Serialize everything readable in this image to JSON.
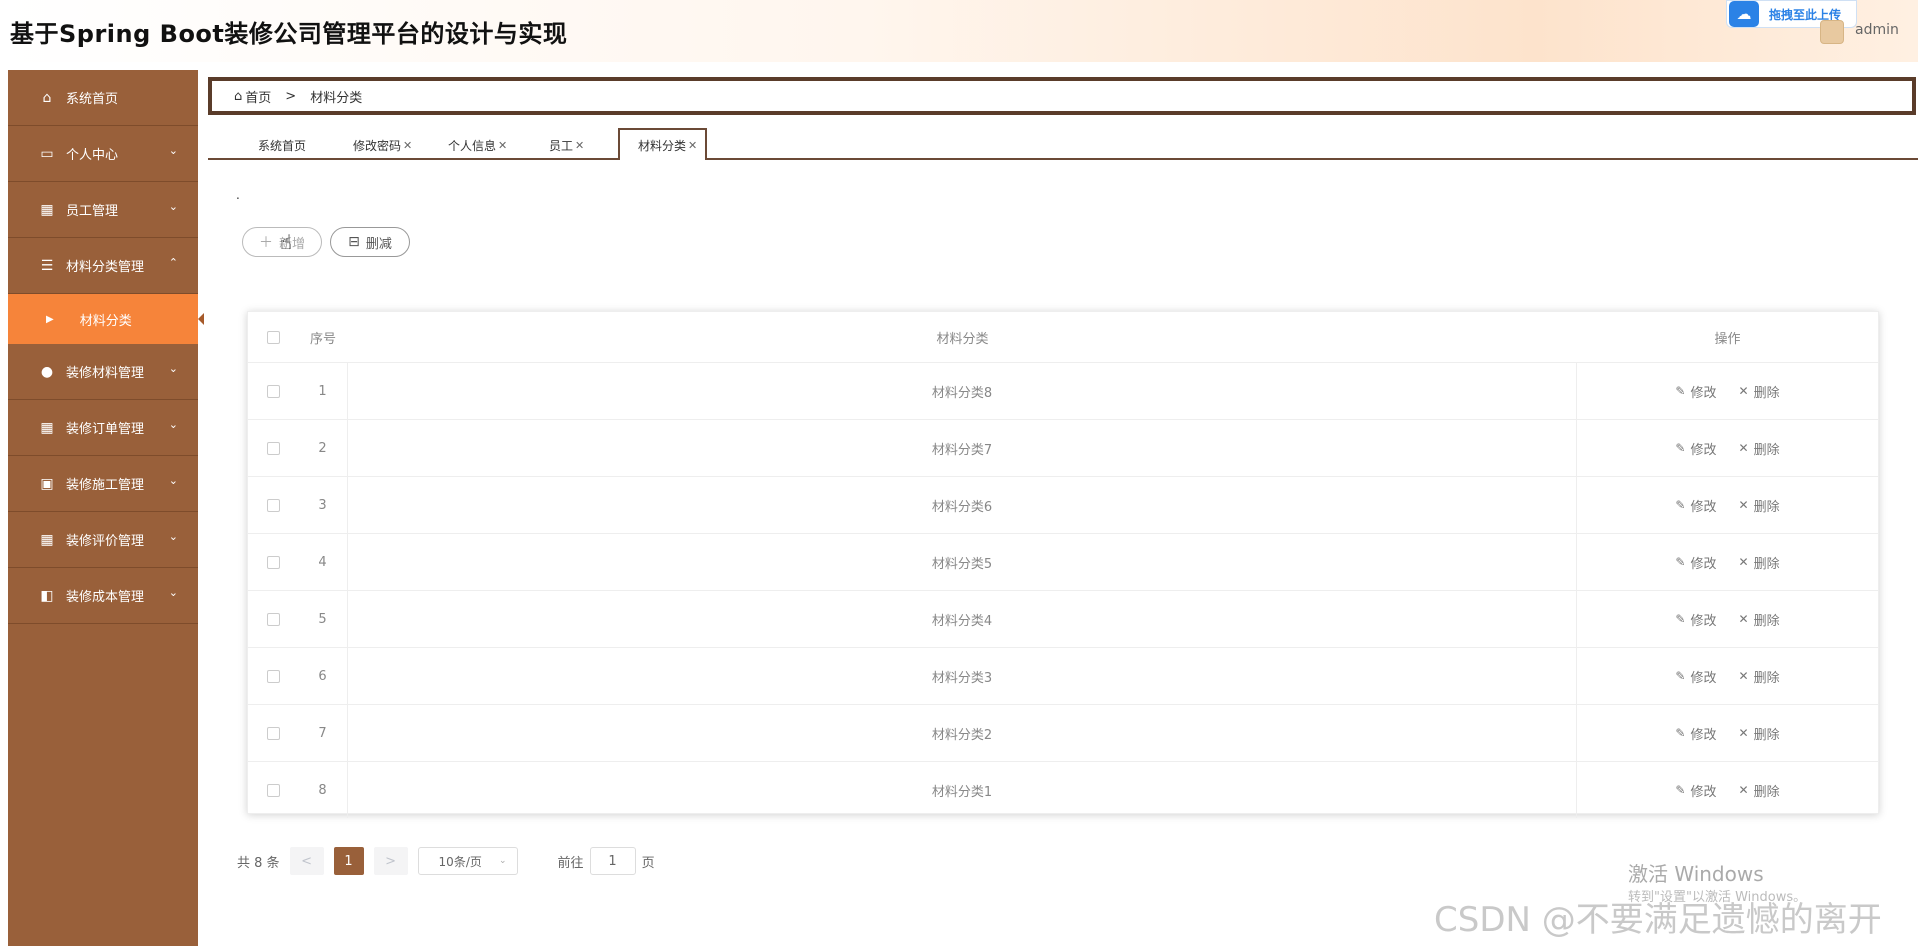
{
  "header": {
    "title": "基于Spring Boot装修公司管理平台的设计与实现",
    "upload_label": "拖拽至此上传",
    "username": "admin"
  },
  "sidebar": {
    "items": [
      {
        "label": "系统首页",
        "icon": "home-icon"
      },
      {
        "label": "个人中心",
        "icon": "card-icon",
        "arrow": "⌄"
      },
      {
        "label": "员工管理",
        "icon": "grid-icon",
        "arrow": "⌄"
      },
      {
        "label": "材料分类管理",
        "icon": "list-icon",
        "arrow": "⌃"
      },
      {
        "label": "装修材料管理",
        "icon": "bulb-icon",
        "arrow": "⌄"
      },
      {
        "label": "装修订单管理",
        "icon": "grid-icon",
        "arrow": "⌄"
      },
      {
        "label": "装修施工管理",
        "icon": "clipboard-icon",
        "arrow": "⌄"
      },
      {
        "label": "装修评价管理",
        "icon": "grid-icon",
        "arrow": "⌄"
      },
      {
        "label": "装修成本管理",
        "icon": "wallet-icon",
        "arrow": "⌄"
      }
    ],
    "active_sub": "材料分类"
  },
  "breadcrumb": {
    "home": "首页",
    "sep": ">",
    "current": "材料分类"
  },
  "tabs": [
    {
      "label": "系统首页",
      "closable": false
    },
    {
      "label": "修改密码",
      "closable": true
    },
    {
      "label": "个人信息",
      "closable": true
    },
    {
      "label": "员工",
      "closable": true
    },
    {
      "label": "材料分类",
      "closable": true,
      "active": true
    }
  ],
  "toolbar": {
    "dot": ".",
    "add_label": "新增",
    "delete_label": "删减"
  },
  "table": {
    "headers": {
      "index": "序号",
      "name": "材料分类",
      "ops": "操作"
    },
    "rows": [
      {
        "index": "1",
        "name": "材料分类8"
      },
      {
        "index": "2",
        "name": "材料分类7"
      },
      {
        "index": "3",
        "name": "材料分类6"
      },
      {
        "index": "4",
        "name": "材料分类5"
      },
      {
        "index": "5",
        "name": "材料分类4"
      },
      {
        "index": "6",
        "name": "材料分类3"
      },
      {
        "index": "7",
        "name": "材料分类2"
      },
      {
        "index": "8",
        "name": "材料分类1"
      }
    ],
    "edit_label": "修改",
    "delete_label": "删除"
  },
  "pager": {
    "total": "共 8 条",
    "prev": "<",
    "current": "1",
    "next": ">",
    "page_size": "10条/页",
    "goto_prefix": "前往",
    "goto_value": "1",
    "goto_suffix": "页"
  },
  "watermarks": {
    "win_line1": "激活 Windows",
    "win_line2": "转到\"设置\"以激活 Windows。",
    "csdn": "CSDN @不要满足遗憾的离开"
  },
  "colors": {
    "sidebar": "#99603a",
    "active": "#f6843a",
    "accent": "#6b4a36"
  }
}
